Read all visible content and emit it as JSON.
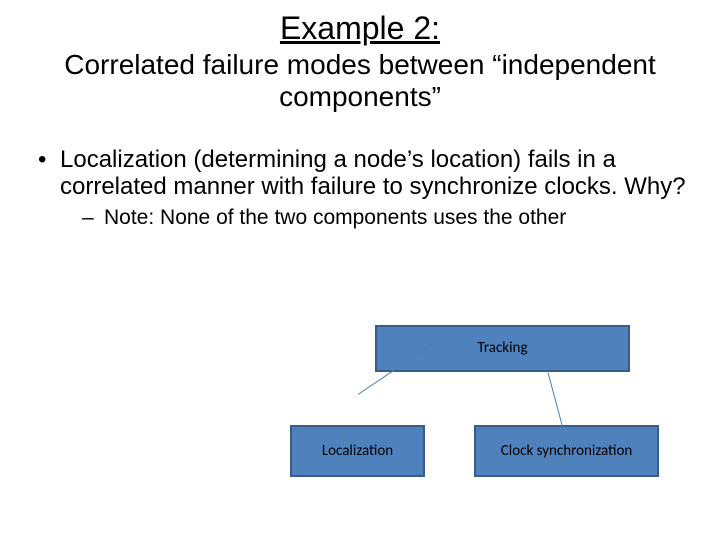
{
  "title": {
    "line1": "Example 2:",
    "line2": "Correlated failure modes between “independent components”"
  },
  "bullets": {
    "b1": "Localization (determining a node’s location) fails in a correlated manner with failure to synchronize clocks. Why?",
    "b1_sub1": "Note: None of the two components uses the other"
  },
  "diagram": {
    "top_box": "Tracking",
    "left_box": "Localization",
    "right_box": "Clock synchronization"
  }
}
